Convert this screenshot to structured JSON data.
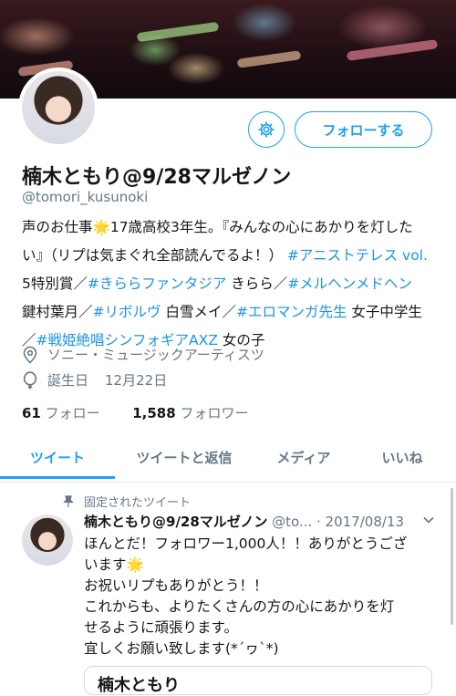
{
  "colors": {
    "accent": "#1da1f2",
    "link": "#1b95e0",
    "muted": "#657786",
    "text": "#14171a"
  },
  "profile": {
    "name": "楠木ともり@9/28マルゼノン",
    "handle": "@tomori_kusunoki",
    "follow_label": "フォローする",
    "settings_icon": "gear-icon",
    "bio": {
      "l1_a": "声のお仕事",
      "l1_b": "17歳高校3年生。『みんなの心にあかりを灯した",
      "l2_a": "い』（リプは気まぐれ全部読んでるよ！）",
      "l2_b": "#アニストテレス vol.",
      "l3_a": "5特別賞／",
      "l3_b": "#きららファンタジア",
      "l3_c": " きらら／",
      "l3_d": "#メルヘンメドヘン",
      "l4_a": "鍵村葉月／",
      "l4_b": "#リボルヴ",
      "l4_c": " 白雪メイ／",
      "l4_d": "#エロマンガ先生",
      "l4_e": " 女子中学生",
      "l5_a": "／",
      "l5_b": "#戦姫絶唱シンフォギアAXZ",
      "l5_c": " 女の子"
    },
    "location": "ソニー・ミュージックアーティスツ",
    "birthday_label": "誕生日",
    "birthday": "12月22日",
    "following_count": "61",
    "following_label": "フォロー",
    "followers_count": "1,588",
    "followers_label": "フォロワー"
  },
  "tabs": [
    "ツイート",
    "ツイートと返信",
    "メディア",
    "いいね"
  ],
  "pinned_tweet": {
    "pinned_label": "固定されたツイート",
    "author": "楠木ともり@9/28マルゼノン",
    "handle": "@to...",
    "date": "· 2017/08/13",
    "lines": [
      "ほんとだ！フォロワー1,000人！！ありがとうござ",
      "います",
      "お祝いリプもありがとう！！",
      "これからも、よりたくさんの方の心にあかりを灯",
      "せるように頑張ります。",
      "宜しくお願い致します(*´ヮ`*)"
    ],
    "quote_preview": "楠木ともり"
  }
}
